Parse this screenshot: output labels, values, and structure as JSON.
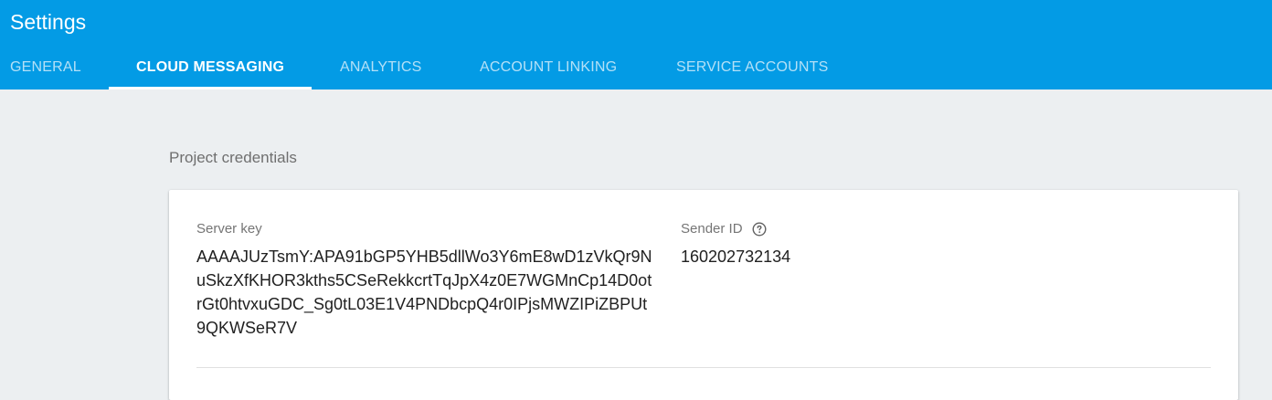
{
  "header": {
    "title": "Settings",
    "tabs": [
      {
        "label": "GENERAL",
        "active": false
      },
      {
        "label": "CLOUD MESSAGING",
        "active": true
      },
      {
        "label": "ANALYTICS",
        "active": false
      },
      {
        "label": "ACCOUNT LINKING",
        "active": false
      },
      {
        "label": "SERVICE ACCOUNTS",
        "active": false
      }
    ]
  },
  "main": {
    "section_title": "Project credentials",
    "server_key_label": "Server key",
    "server_key_value": "AAAAJUzTsmY:APA91bGP5YHB5dllWo3Y6mE8wD1zVkQr9NuSkzXfKHOR3kths5CSeRekkcrtTqJpX4z0E7WGMnCp14D0otrGt0htvxuGDC_Sg0tL03E1V4PNDbcpQ4r0IPjsMWZIPiZBPUt9QKWSeR7V",
    "sender_id_label": "Sender ID",
    "sender_id_value": "160202732134",
    "help_icon": "help-circle-icon"
  },
  "colors": {
    "header_bg": "#039be5",
    "page_bg": "#eceff1",
    "tab_inactive": "#b3e0f7",
    "tab_active": "#ffffff"
  }
}
